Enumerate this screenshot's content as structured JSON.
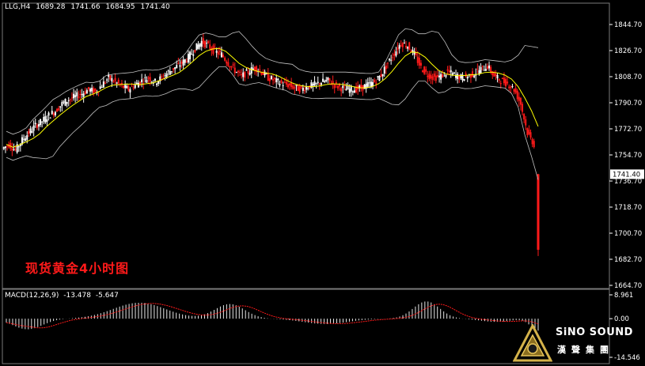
{
  "header": {
    "symbol": "LLG,H4",
    "open": "1689.28",
    "high": "1741.66",
    "low": "1684.95",
    "close": "1741.40"
  },
  "overlay_title": "现货黄金4小时图",
  "macd_header": {
    "name": "MACD(12,26,9)",
    "main": "-13.478",
    "signal": "-5.647"
  },
  "brand": {
    "name": "SiNO SOUND",
    "sub": "漢聲集團"
  },
  "colors": {
    "background": "#000000",
    "bull_candle": "#ffffff",
    "bear_candle": "#ff1a1a",
    "bands": "#c0c0c0",
    "ma": "#ffff00",
    "macd_hist": "#ffffff",
    "macd_signal": "#ff1a1a",
    "current_price_tag": "#ffffff"
  },
  "chart_data": [
    {
      "type": "candlestick",
      "title": "现货黄金4小时图",
      "symbol": "LLG",
      "timeframe": "H4",
      "ylim": [
        1660,
        1853
      ],
      "y_ticks": [
        "1844.70",
        "1826.70",
        "1808.70",
        "1790.70",
        "1772.70",
        "1754.70",
        "1736.70",
        "1718.70",
        "1700.70",
        "1682.70",
        "1664.70"
      ],
      "current_price": "1741.40",
      "indicators": [
        "Bollinger Bands",
        "Moving Average"
      ],
      "close_series": [
        1762,
        1758,
        1765,
        1770,
        1775,
        1778,
        1782,
        1785,
        1790,
        1793,
        1795,
        1797,
        1800,
        1798,
        1803,
        1808,
        1805,
        1802,
        1800,
        1803,
        1806,
        1808,
        1805,
        1808,
        1812,
        1815,
        1818,
        1822,
        1828,
        1833,
        1830,
        1826,
        1824,
        1818,
        1813,
        1809,
        1812,
        1815,
        1812,
        1808,
        1806,
        1804,
        1803,
        1801,
        1800,
        1802,
        1803,
        1805,
        1806,
        1803,
        1801,
        1800,
        1800,
        1801,
        1803,
        1805,
        1810,
        1818,
        1825,
        1832,
        1830,
        1824,
        1815,
        1810,
        1808,
        1809,
        1812,
        1810,
        1808,
        1809,
        1811,
        1814,
        1816,
        1809,
        1806,
        1804,
        1800,
        1790,
        1770,
        1762,
        1741.4
      ],
      "last_candle": {
        "open": 1689.28,
        "high": 1741.66,
        "low": 1684.95,
        "close": 1741.4
      }
    },
    {
      "type": "histogram",
      "title": "MACD(12,26,9)",
      "main": -13.478,
      "signal": -5.647,
      "y_ticks": [
        "8.961",
        "0.00",
        "-14.546"
      ],
      "ylim": [
        -14.546,
        8.961
      ]
    }
  ]
}
